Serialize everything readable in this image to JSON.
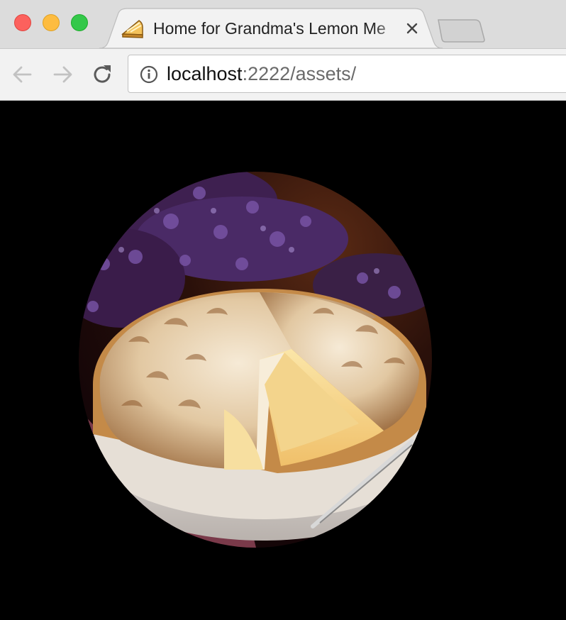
{
  "window": {
    "controls": [
      "close",
      "minimize",
      "zoom"
    ],
    "colors": {
      "close": "#fc615d",
      "minimize": "#fdbc40",
      "zoom": "#34c84a"
    }
  },
  "tab": {
    "title": "Home for Grandma's Lemon Me",
    "favicon": "pie-icon",
    "close_icon": "close-icon"
  },
  "toolbar": {
    "back_icon": "arrow-left-icon",
    "forward_icon": "arrow-right-icon",
    "reload_icon": "reload-icon",
    "info_icon": "info-icon"
  },
  "address_bar": {
    "host": "localhost",
    "path": ":2222/assets/"
  },
  "content": {
    "image": "lemon-meringue-pie-photo",
    "background": "#000000"
  }
}
